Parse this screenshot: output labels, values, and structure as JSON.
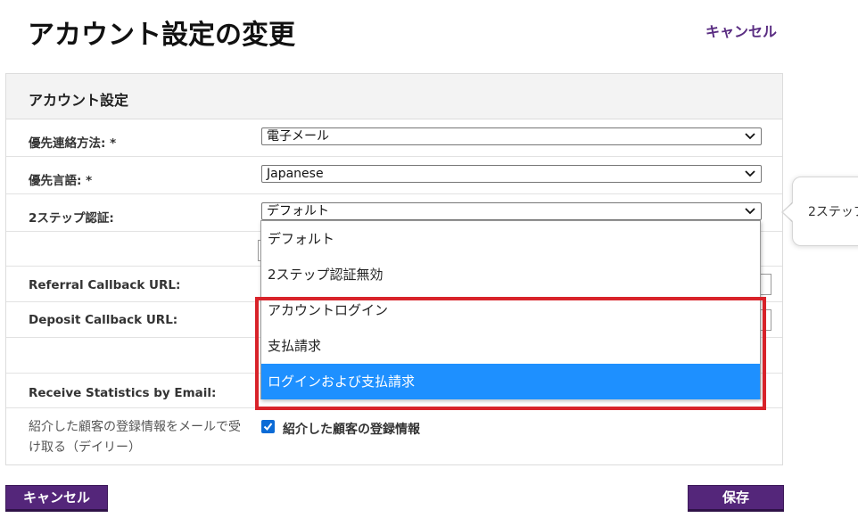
{
  "header": {
    "title": "アカウント設定の変更",
    "cancel_label": "キャンセル"
  },
  "panel": {
    "title": "アカウント設定",
    "fields": {
      "contact_method": {
        "label": "優先連絡方法: *",
        "value": "電子メール"
      },
      "language": {
        "label": "優先言語: *",
        "value": "Japanese"
      },
      "two_step": {
        "label": "2ステップ認証:",
        "value": "デフォルト"
      },
      "referral_callback": {
        "label": "Referral Callback URL:"
      },
      "deposit_callback": {
        "label": "Deposit Callback URL:"
      },
      "receive_stats": {
        "label": "Receive Statistics by Email:"
      },
      "referral_email": {
        "label": "紹介した顧客の登録情報をメールで受け取る（デイリー）",
        "checkbox_label": "紹介した顧客の登録情報",
        "checked": true
      }
    }
  },
  "dropdown": {
    "options": [
      "デフォルト",
      "2ステップ認証無効",
      "アカウントログイン",
      "支払請求",
      "ログインおよび支払請求"
    ],
    "highlighted_index": 4
  },
  "tooltip": {
    "text": "2ステップ"
  },
  "footer": {
    "cancel_label": "キャンセル",
    "save_label": "保存"
  },
  "colors": {
    "brand_purple": "#54267a",
    "highlight_blue": "#1e90ff",
    "annotation_red": "#d8232a"
  }
}
